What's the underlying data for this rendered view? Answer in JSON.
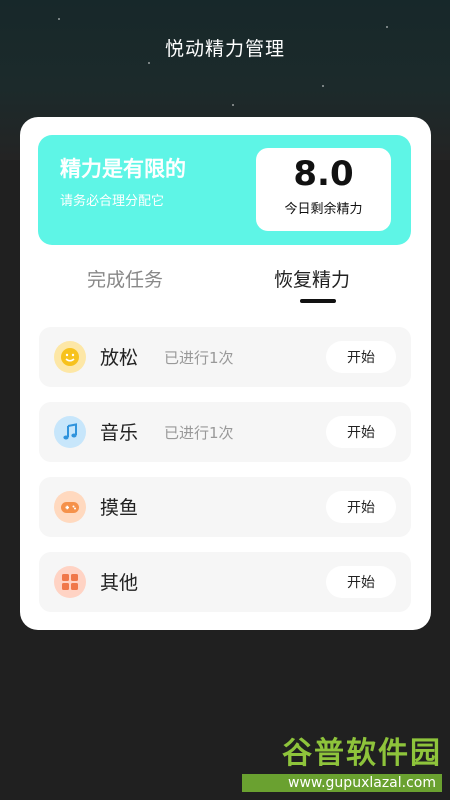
{
  "app": {
    "title": "悦动精力管理"
  },
  "energy": {
    "headline": "精力是有限的",
    "subtitle": "请务必合理分配它",
    "value": "8.0",
    "label": "今日剩余精力"
  },
  "tabs": [
    {
      "label": "完成任务",
      "active": false
    },
    {
      "label": "恢复精力",
      "active": true
    }
  ],
  "activities": [
    {
      "name": "放松",
      "status": "已进行1次",
      "button": "开始",
      "icon": "smile-icon",
      "icon_bg": "#fde7a6",
      "icon_color": "#f5b400"
    },
    {
      "name": "音乐",
      "status": "已进行1次",
      "button": "开始",
      "icon": "music-note-icon",
      "icon_bg": "#c7e6fb",
      "icon_color": "#3aa0e8"
    },
    {
      "name": "摸鱼",
      "status": "",
      "button": "开始",
      "icon": "gamepad-icon",
      "icon_bg": "#ffd9bf",
      "icon_color": "#f59a5b"
    },
    {
      "name": "其他",
      "status": "",
      "button": "开始",
      "icon": "grid-icon",
      "icon_bg": "#ffd3c4",
      "icon_color": "#f0784a"
    }
  ],
  "watermark": {
    "logo": "谷普软件园",
    "url": "www.gupuxlazal.com"
  },
  "colors": {
    "accent": "#5ef5e6",
    "background": "#202020",
    "card": "#ffffff"
  }
}
